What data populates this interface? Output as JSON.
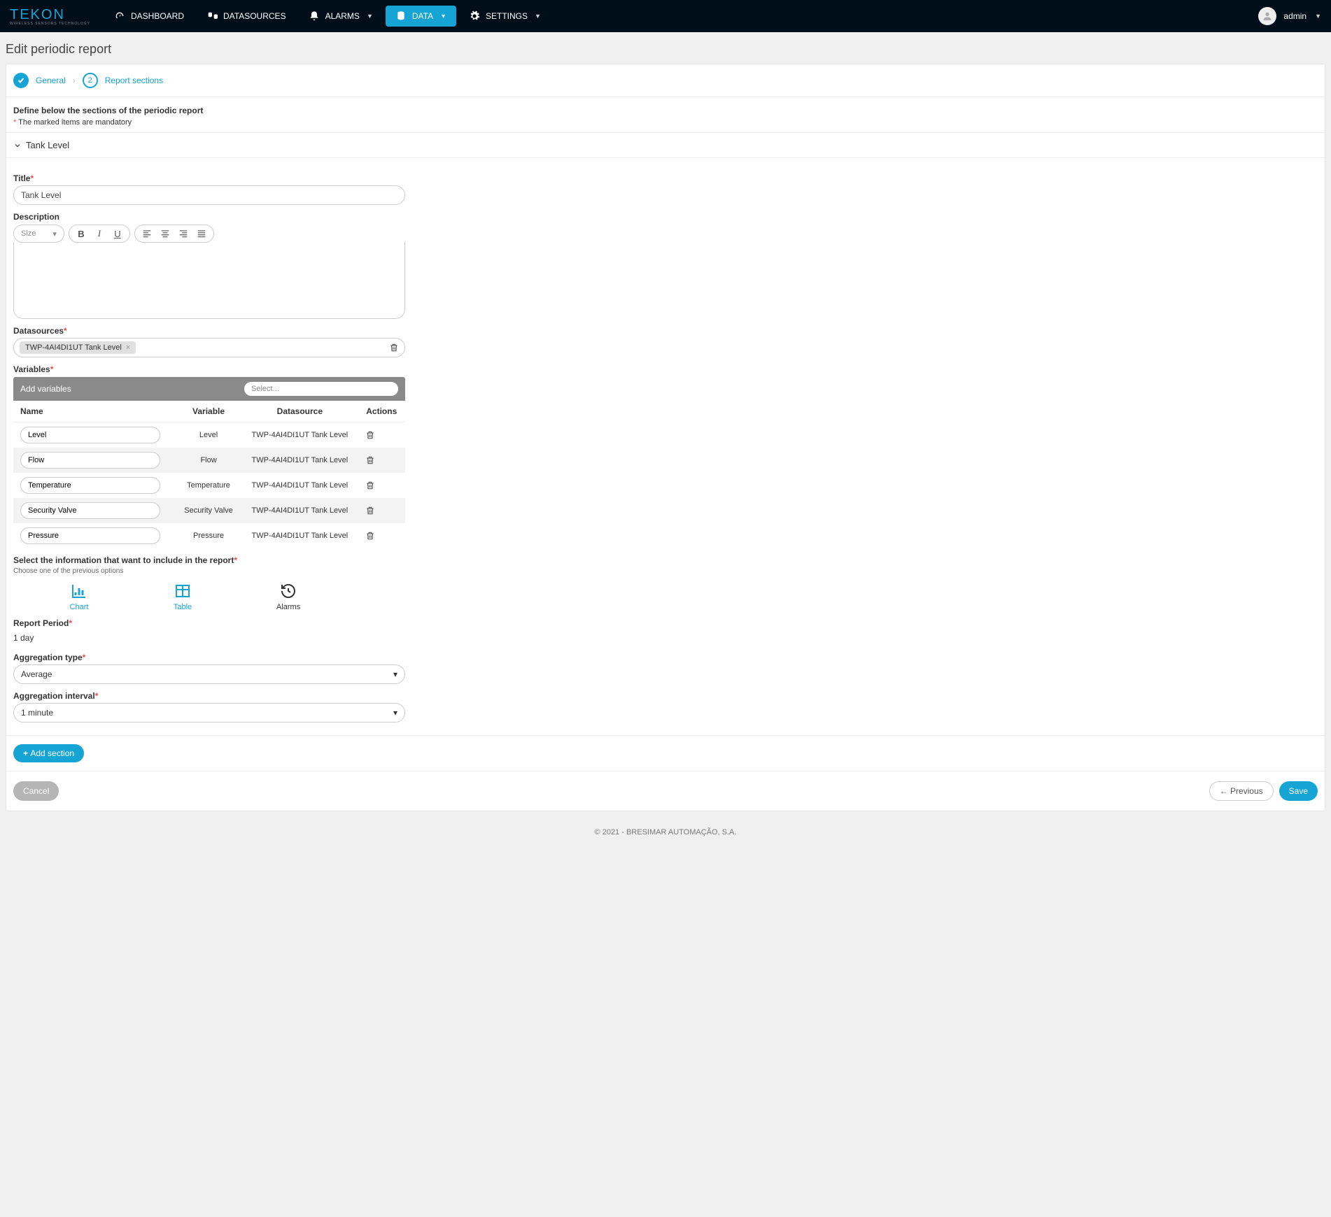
{
  "nav": {
    "dashboard": "DASHBOARD",
    "datasources": "DATASOURCES",
    "alarms": "ALARMS",
    "data": "DATA",
    "settings": "SETTINGS",
    "user": "admin"
  },
  "page": {
    "title": "Edit periodic report"
  },
  "stepper": {
    "step1": "General",
    "step2num": "2",
    "step2": "Report sections"
  },
  "instructions": {
    "heading": "Define below the sections of the periodic report",
    "mandatory": "The marked items are mandatory"
  },
  "section": {
    "name": "Tank Level",
    "labels": {
      "title": "Title",
      "description": "Description",
      "size": "Size",
      "datasources": "Datasources",
      "variables": "Variables",
      "addVariables": "Add variables",
      "selectPlaceholder": "Select...",
      "colName": "Name",
      "colVariable": "Variable",
      "colDatasource": "Datasource",
      "colActions": "Actions",
      "includeHeading": "Select the information that want to include in the report",
      "includeNote": "Choose one of the previous options",
      "chart": "Chart",
      "table": "Table",
      "alarms": "Alarms",
      "reportPeriod": "Report Period",
      "aggType": "Aggregation type",
      "aggInterval": "Aggregation interval"
    },
    "titleValue": "Tank Level",
    "datasourceChip": "TWP-4AI4DI1UT Tank Level",
    "variables": [
      {
        "name": "Level",
        "variable": "Level",
        "datasource": "TWP-4AI4DI1UT Tank Level"
      },
      {
        "name": "Flow",
        "variable": "Flow",
        "datasource": "TWP-4AI4DI1UT Tank Level"
      },
      {
        "name": "Temperature",
        "variable": "Temperature",
        "datasource": "TWP-4AI4DI1UT Tank Level"
      },
      {
        "name": "Security Valve",
        "variable": "Security Valve",
        "datasource": "TWP-4AI4DI1UT Tank Level"
      },
      {
        "name": "Pressure",
        "variable": "Pressure",
        "datasource": "TWP-4AI4DI1UT Tank Level"
      }
    ],
    "reportPeriodValue": "1 day",
    "aggTypeValue": "Average",
    "aggIntervalValue": "1 minute"
  },
  "buttons": {
    "addSection": "Add section",
    "cancel": "Cancel",
    "previous": "Previous",
    "save": "Save"
  },
  "footer": {
    "copyright": "© 2021 - BRESIMAR AUTOMAÇÃO, S.A."
  }
}
